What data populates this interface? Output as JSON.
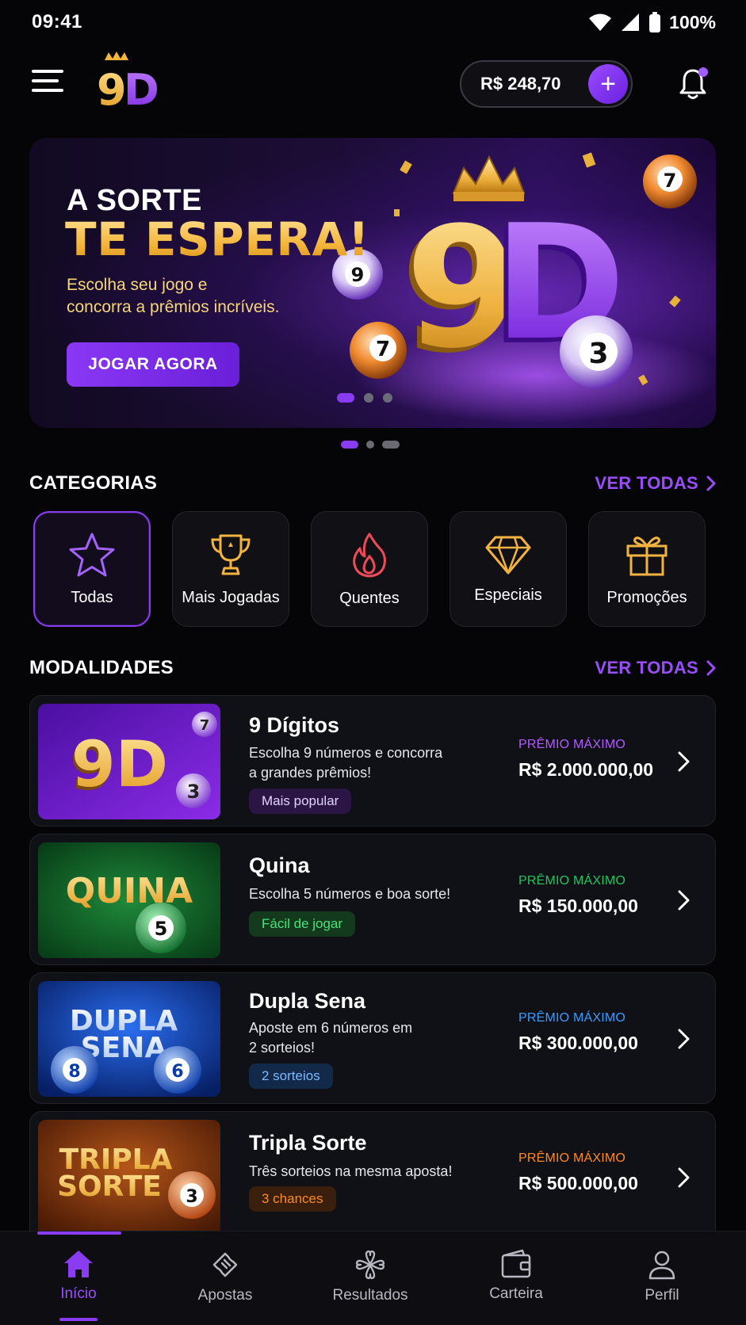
{
  "status_bar": {
    "time": "09:41",
    "battery": "100%"
  },
  "header": {
    "logo_text": "9D",
    "balance": "R$ 248,70",
    "add_symbol": "+"
  },
  "banner": {
    "title_line1": "A SORTE",
    "title_line2": "TE ESPERA!",
    "subtitle_line1": "Escolha seu jogo e",
    "subtitle_line2": "concorra a prêmios incríveis.",
    "cta_label": "JOGAR AGORA",
    "art_text": "9D",
    "balls": [
      "9",
      "7",
      "3",
      "7"
    ]
  },
  "categories": {
    "title": "CATEGORIAS",
    "see_all": "VER TODAS",
    "items": [
      {
        "label": "Todas",
        "icon": "star-icon",
        "active": true
      },
      {
        "label": "Mais Jogadas",
        "icon": "trophy-icon"
      },
      {
        "label": "Quentes",
        "icon": "flame-icon"
      },
      {
        "label": "Especiais",
        "icon": "diamond-icon"
      },
      {
        "label": "Promoções",
        "icon": "gift-icon"
      }
    ]
  },
  "modalities": {
    "title": "MODALIDADES",
    "see_all": "VER TODAS",
    "games": [
      {
        "name": "9 Dígitos",
        "desc_line1": "Escolha 9 números e concorra",
        "desc_line2": "a grandes prêmios!",
        "tag": "Mais popular",
        "prize_label": "PRÊMIO MÁXIMO",
        "prize": "R$ 2.000.000,00",
        "thumb_text": "9D",
        "accent": "#b15cff"
      },
      {
        "name": "Quina",
        "desc_line1": "Escolha 5 números e boa sorte!",
        "desc_line2": "",
        "tag": "Fácil de jogar",
        "prize_label": "PRÊMIO MÁXIMO",
        "prize": "R$ 150.000,00",
        "thumb_text": "QUINA",
        "thumb_ball": "5",
        "accent": "#22c55e"
      },
      {
        "name": "Dupla Sena",
        "desc_line1": "Aposte em 6 números em",
        "desc_line2": "2 sorteios!",
        "tag": "2 sorteios",
        "prize_label": "PRÊMIO MÁXIMO",
        "prize": "R$ 300.000,00",
        "thumb_text1": "DUPLA",
        "thumb_text2": "SENA",
        "thumb_ball": "8",
        "thumb_ball2": "6",
        "accent": "#3b9bff"
      },
      {
        "name": "Tripla Sorte",
        "desc_line1": "Três sorteios na mesma aposta!",
        "desc_line2": "",
        "tag": "3 chances",
        "prize_label": "PRÊMIO MÁXIMO",
        "prize": "R$ 500.000,00",
        "thumb_text1": "TRIPLA",
        "thumb_text2": "SORTE",
        "thumb_ball": "3",
        "accent": "#ff8a1f"
      }
    ]
  },
  "nav": {
    "items": [
      {
        "label": "Início",
        "icon": "home-icon",
        "active": true
      },
      {
        "label": "Apostas",
        "icon": "ticket-icon"
      },
      {
        "label": "Resultados",
        "icon": "clover-icon"
      },
      {
        "label": "Carteira",
        "icon": "wallet-icon"
      },
      {
        "label": "Perfil",
        "icon": "user-icon"
      }
    ]
  }
}
